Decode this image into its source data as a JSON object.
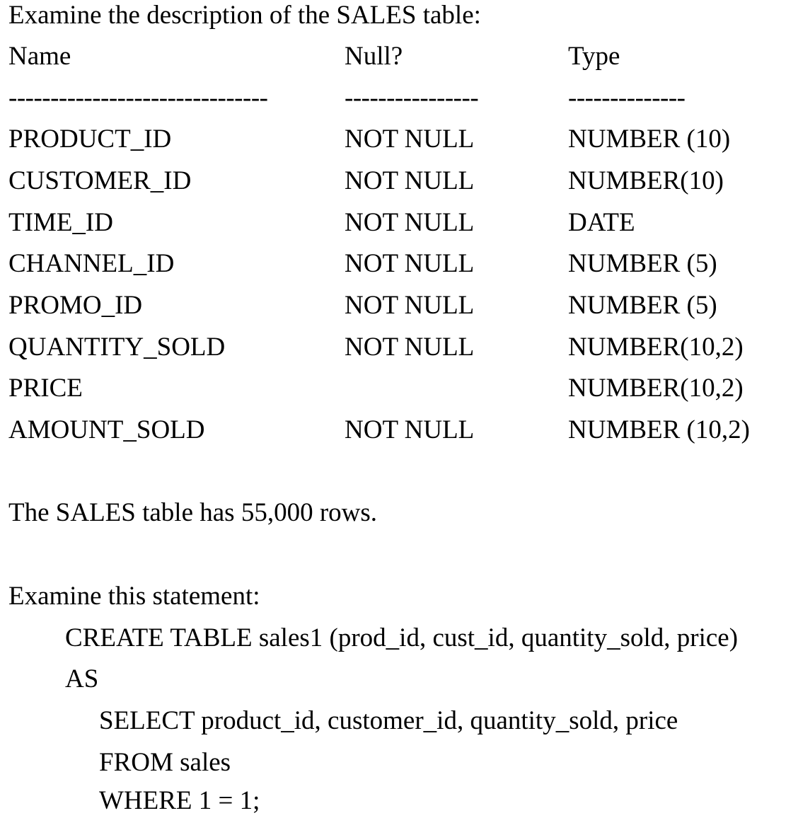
{
  "intro": "Examine the description of the SALES table:",
  "table": {
    "headers": [
      "Name",
      "Null?",
      "Type"
    ],
    "dashes": [
      "-------------------------------",
      "----------------",
      "--------------"
    ],
    "rows": [
      [
        "PRODUCT_ID",
        "NOT NULL",
        "NUMBER (10)"
      ],
      [
        "CUSTOMER_ID",
        "NOT NULL",
        "NUMBER(10)"
      ],
      [
        "TIME_ID",
        "NOT NULL",
        "DATE"
      ],
      [
        "CHANNEL_ID",
        "NOT NULL",
        "NUMBER (5)"
      ],
      [
        "PROMO_ID",
        "NOT NULL",
        "NUMBER (5)"
      ],
      [
        "QUANTITY_SOLD",
        "NOT NULL",
        "NUMBER(10,2)"
      ],
      [
        "PRICE",
        "",
        "NUMBER(10,2)"
      ],
      [
        "AMOUNT_SOLD",
        "NOT NULL",
        "NUMBER (10,2)"
      ]
    ]
  },
  "rows_note": "The SALES table has 55,000 rows.",
  "statement_intro": "Examine this statement:",
  "statement": {
    "line1": "CREATE TABLE sales1 (prod_id, cust_id, quantity_sold, price)",
    "line2": "AS",
    "line3": "SELECT product_id, customer_id, quantity_sold, price",
    "line4": "FROM sales",
    "line5": "WHERE 1 = 1;"
  }
}
